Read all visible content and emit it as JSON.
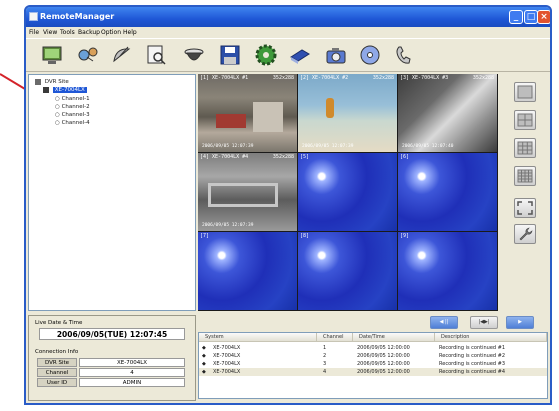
{
  "window": {
    "title": "RemoteManager",
    "controls": {
      "minimize": "_",
      "maximize": "□",
      "close": "×"
    }
  },
  "menu": [
    "File",
    "View",
    "Tools",
    "Backup",
    "Option",
    "Help"
  ],
  "toolbar": {
    "icons": [
      "monitor-icon",
      "network-icon",
      "satellite-dish-icon",
      "search-playback-icon",
      "dome-camera-icon",
      "save-icon",
      "settings-gear-icon",
      "book-icon",
      "snapshot-camera-icon",
      "disc-icon",
      "phone-icon"
    ]
  },
  "tree": {
    "root": "DVR Site",
    "site": "XE-7004LX",
    "channels": [
      "Channel-1",
      "Channel-2",
      "Channel-3",
      "Channel-4"
    ]
  },
  "info": {
    "live_label": "Live Date & Time",
    "datetime": "2006/09/05(TUE) 12:07:45",
    "connection_label": "Connection Info",
    "rows": [
      {
        "key": "DVR Site",
        "value": "XE-7004LX"
      },
      {
        "key": "Channel",
        "value": "4"
      },
      {
        "key": "User ID",
        "value": "ADMIN"
      }
    ]
  },
  "cameras": [
    {
      "label": "[1] XE-7004LX #1",
      "res": "352x288",
      "stamp": "2006/09/05 12:07:39"
    },
    {
      "label": "[2] XE-7004LX #2",
      "res": "352x288",
      "stamp": "2006/09/05 12:07:39"
    },
    {
      "label": "[3] XE-7004LX #3",
      "res": "352x288",
      "stamp": "2006/09/05 12:07:40"
    },
    {
      "label": "[4] XE-7004LX #4",
      "res": "352x288",
      "stamp": "2006/09/05 12:07:39"
    },
    {
      "label": "[5]",
      "res": "",
      "stamp": ""
    },
    {
      "label": "[6]",
      "res": "",
      "stamp": ""
    },
    {
      "label": "[7]",
      "res": "",
      "stamp": ""
    },
    {
      "label": "[8]",
      "res": "",
      "stamp": ""
    },
    {
      "label": "[9]",
      "res": "",
      "stamp": ""
    }
  ],
  "playback": {
    "btn1": "◀ ||",
    "btn2": "|◀▶|",
    "btn3": "▶"
  },
  "log": {
    "headers": [
      "System",
      "Channel",
      "Date/Time",
      "Description"
    ],
    "rows": [
      {
        "system": "XE-7004LX",
        "channel": "1",
        "datetime": "2006/09/05 12:00:00",
        "description": "Recording is continued #1"
      },
      {
        "system": "XE-7004LX",
        "channel": "2",
        "datetime": "2006/09/05 12:00:00",
        "description": "Recording is continued #2"
      },
      {
        "system": "XE-7004LX",
        "channel": "3",
        "datetime": "2006/09/05 12:00:00",
        "description": "Recording is continued #3"
      },
      {
        "system": "XE-7004LX",
        "channel": "4",
        "datetime": "2006/09/05 12:00:00",
        "description": "Recording is continued #4"
      }
    ]
  },
  "colors": {
    "titlebar": "#1f57d6",
    "accent_blue": "#2642c4",
    "pointer": "#d4232a"
  }
}
